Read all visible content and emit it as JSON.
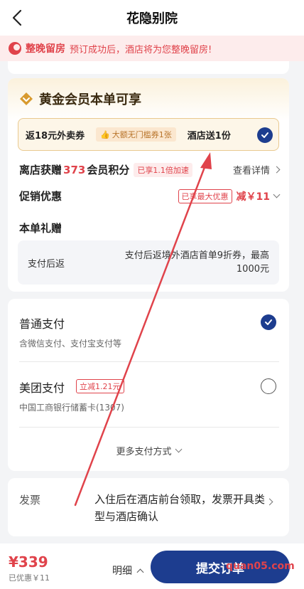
{
  "header": {
    "title": "花隐别院"
  },
  "notice": {
    "tag": "整晚留房",
    "text": "预订成功后，酒店将为您整晚留房!"
  },
  "member": {
    "title": "黄金会员本单可享",
    "perk_coupon": "返18元外卖券",
    "perk_badge": "大额无门槛券1张",
    "perk_hotel": "酒店送1份",
    "points_prefix": "离店获赠",
    "points_value": "373",
    "points_suffix": "会员积分",
    "points_badge": "已享1.1倍加速",
    "points_more": "查看详情",
    "promo_label": "促销优惠",
    "promo_badge": "已享最大优惠",
    "promo_amount": "减￥11",
    "gift_label": "本单礼赠",
    "gift_left": "支付后返",
    "gift_right": "支付后返境外酒店首单9折券，最高1000元"
  },
  "payment": {
    "option1_title": "普通支付",
    "option1_sub": "含微信支付、支付宝支付等",
    "option2_title": "美团支付",
    "option2_badge": "立减1.21元",
    "option2_sub": "中国工商银行储蓄卡(1307)",
    "more": "更多支付方式"
  },
  "invoice": {
    "label": "发票",
    "text": "入住后在酒店前台领取，发票开具类型与酒店确认"
  },
  "bottom": {
    "price": "¥339",
    "saved": "已优惠￥11",
    "detail": "明细",
    "submit": "提交订单",
    "watermark": "quan05.com"
  },
  "colors": {
    "brand_blue": "#1d3d8f",
    "accent_red": "#e0434b",
    "gold": "#e9c98f"
  }
}
